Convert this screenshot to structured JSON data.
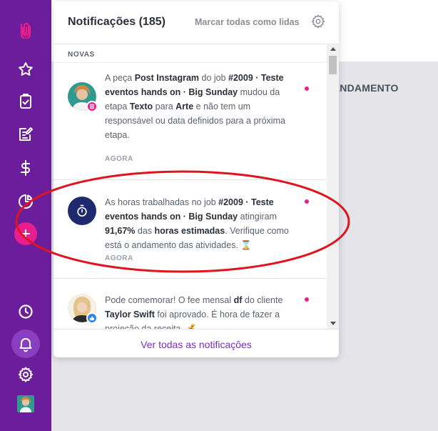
{
  "sidebar": {
    "items": [
      {
        "name": "logo",
        "icon": "paperclip-logo-icon"
      },
      {
        "name": "favorites",
        "icon": "star-icon"
      },
      {
        "name": "tasks",
        "icon": "clipboard-check-icon"
      },
      {
        "name": "edit",
        "icon": "edit-document-icon"
      },
      {
        "name": "finance",
        "icon": "dollar-icon"
      },
      {
        "name": "reports",
        "icon": "pie-chart-icon"
      },
      {
        "name": "add",
        "icon": "plus-icon"
      },
      {
        "name": "history",
        "icon": "clock-icon"
      },
      {
        "name": "notifications",
        "icon": "bell-icon"
      },
      {
        "name": "settings",
        "icon": "gear-icon"
      },
      {
        "name": "profile",
        "icon": "avatar"
      }
    ]
  },
  "background": {
    "column_label": "ANDAMENTO"
  },
  "panel": {
    "title": "Notificações (185)",
    "mark_all": "Marcar todas como lidas",
    "section_label": "NOVAS",
    "footer_link": "Ver todas as notificações"
  },
  "notifications": [
    {
      "segments": [
        "A peça ",
        "Post Instagram",
        " do job ",
        "#2009 · Teste eventos hands on · Big Sunday",
        " mudou da etapa ",
        "Texto",
        " para ",
        "Arte",
        " e não tem um responsável ou data definidos para a próxima etapa."
      ],
      "time": "AGORA"
    },
    {
      "segments": [
        "As horas trabalhadas no job ",
        "#2009 · Teste eventos hands on · Big Sunday",
        " atingiram ",
        "91,67%",
        " das ",
        "horas estimadas",
        ". Verifique como está o andamento das atividades. ",
        "⌛"
      ],
      "time": "AGORA"
    },
    {
      "segments": [
        "Pode comemorar! O fee mensal ",
        "df",
        " do cliente ",
        "Taylor Swift",
        " foi aprovado. É hora de fazer a projeção da receita. ",
        "💰"
      ],
      "time": ""
    }
  ],
  "colors": {
    "sidebar": "#6c1d9c",
    "accent_pink": "#e91e8c",
    "link_purple": "#7a2fbf",
    "annotation_red": "#e0141e"
  }
}
